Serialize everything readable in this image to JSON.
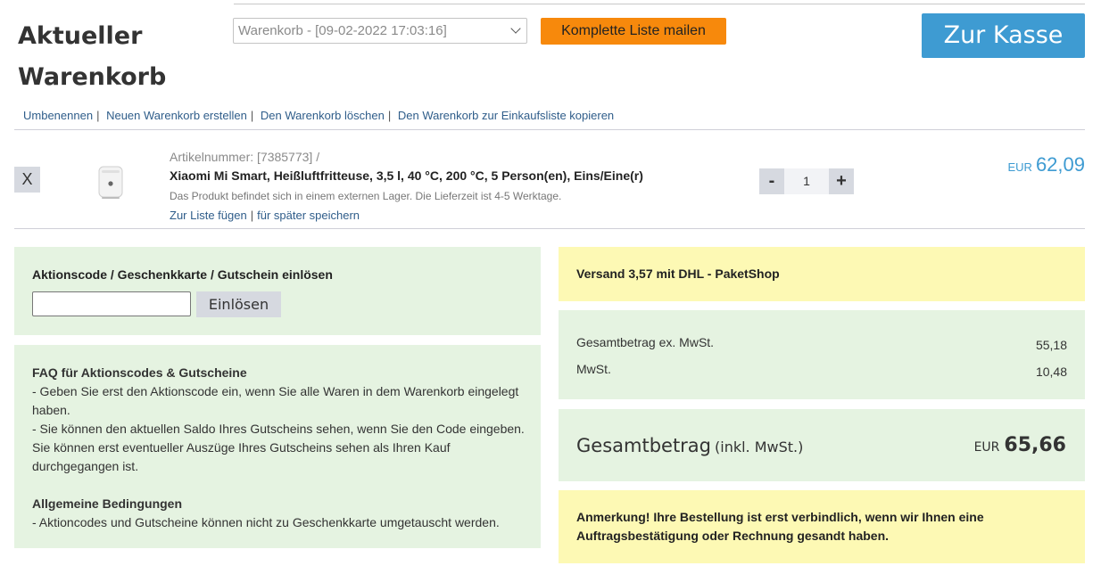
{
  "header": {
    "title": "Aktueller Warenkorb",
    "cart_select_value": "Warenkorb - [09-02-2022 17:03:16]",
    "mail_label": "Komplette Liste mailen",
    "checkout_label": "Zur Kasse"
  },
  "cart_actions": [
    {
      "label": "Umbenennen",
      "sep": "|"
    },
    {
      "label": "Neuen Warenkorb erstellen",
      "sep": "|"
    },
    {
      "label": "Den Warenkorb löschen",
      "sep": "|"
    },
    {
      "label": "Den Warenkorb zur Einkaufsliste kopieren",
      "sep": ""
    }
  ],
  "item": {
    "remove_label": "X",
    "article_number": "Artikelnummer: [7385773] /",
    "name": "Xiaomi Mi Smart, Heißluftfritteuse, 3,5 l, 40 °C, 200 °C, 5 Person(en), Eins/Eine(r)",
    "stock_info": "Das Produkt befindet sich in einem externen Lager. Die Lieferzeit ist 4-5 Werktage.",
    "add_to_list": "Zur Liste fügen",
    "link_sep": "|",
    "save_for_later": "für später speichern",
    "qty_minus": "-",
    "quantity": "1",
    "qty_plus": "+",
    "price_currency": "EUR",
    "price_amount": "62,09",
    "image_icon": "air-fryer-icon"
  },
  "voucher": {
    "title": "Aktionscode / Geschenkkarte / Gutschein einlösen",
    "input_value": "",
    "redeem_label": "Einlösen"
  },
  "faq": {
    "heading": "FAQ für Aktionscodes & Gutscheine",
    "line1": "- Geben Sie erst den Aktionscode ein, wenn Sie alle Waren in dem Warenkorb eingelegt haben.",
    "line2": "- Sie können den aktuellen Saldo Ihres Gutscheins sehen, wenn Sie den Code eingeben. Sie können erst eventueller Auszüge Ihres Gutscheins sehen als Ihren Kauf durchgegangen ist.",
    "heading2": "Allgemeine Bedingungen",
    "line3": "- Aktioncodes und Gutscheine können nicht zu Geschenkkarte umgetauscht werden."
  },
  "shipping": {
    "text": "Versand 3,57 mit DHL - PaketShop"
  },
  "summary": {
    "net_label": "Gesamtbetrag ex. MwSt.",
    "net_value": "55,18",
    "vat_label": "MwSt.",
    "vat_value": "10,48",
    "total_label": "Gesamtbetrag",
    "total_sub": "(inkl. MwSt.)",
    "total_currency": "EUR",
    "total_amount": "65,66"
  },
  "note": {
    "text": "Anmerkung! Ihre Bestellung ist erst verbindlich, wenn wir Ihnen eine Auftragsbestätigung oder Rechnung gesandt haben."
  },
  "colors": {
    "accent_blue": "#3e9bd2",
    "mail_orange": "#f7890c",
    "panel_green": "#e5f3e1",
    "panel_yellow": "#fdf9b4",
    "link_blue": "#2f5d8a"
  }
}
